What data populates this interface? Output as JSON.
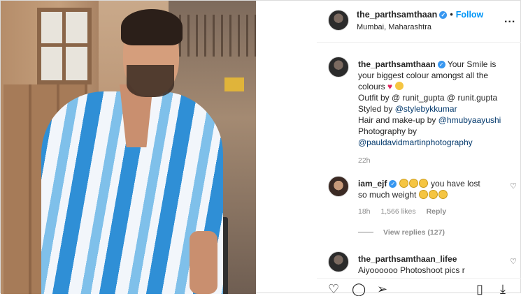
{
  "header": {
    "username": "the_parthsamthaan",
    "follow_label": "Follow",
    "location": "Mumbai, Maharashtra",
    "separator": "•",
    "more_label": "..."
  },
  "caption": {
    "username": "the_parthsamthaan",
    "line1": "Your Smile is your biggest colour amongst all the colours",
    "line2a": "Outfit by @ ",
    "line2b": "runit_gupta @ runit.gupta",
    "line3a": "Styled by ",
    "line3b": "@stylebykkumar",
    "line4a": "Hair and make-up by ",
    "line4b": "@hmubyaayushi",
    "line5": "Photography by",
    "line6": "@pauldavidmartinphotography",
    "time": "22h"
  },
  "comments": [
    {
      "username": "iam_ejf",
      "text_a": "you have lost",
      "text_b": "so much weight",
      "time": "18h",
      "likes": "1,566 likes",
      "reply_label": "Reply"
    },
    {
      "username": "the_parthsamthaan_lifee",
      "text": "Aiyoooooo Photoshoot pics r"
    }
  ],
  "view_replies": "View replies (127)",
  "icons": {
    "verified": "verified-badge",
    "heart": "heart-icon",
    "comment": "comment-icon",
    "share": "share-icon",
    "save": "bookmark-icon",
    "more": "more-icon"
  },
  "colors": {
    "link": "#00376b",
    "follow": "#0095f6",
    "verified": "#3897f0",
    "muted": "#8e8e8e"
  }
}
